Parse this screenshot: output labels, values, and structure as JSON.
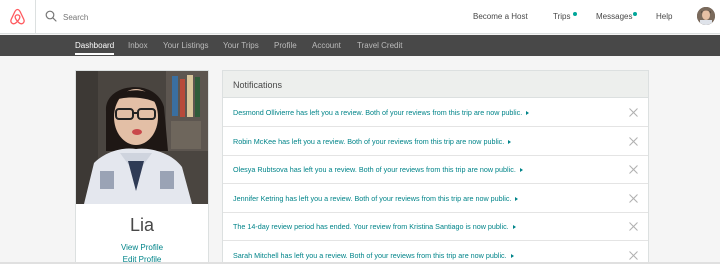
{
  "topbar": {
    "search_placeholder": "Search",
    "become_host": "Become a Host",
    "trips": "Trips",
    "messages": "Messages",
    "help": "Help"
  },
  "subnav": {
    "items": [
      "Dashboard",
      "Inbox",
      "Your Listings",
      "Your Trips",
      "Profile",
      "Account",
      "Travel Credit"
    ],
    "active": "Dashboard"
  },
  "profile": {
    "name": "Lia",
    "view_profile": "View Profile",
    "edit_profile": "Edit Profile"
  },
  "notifications": {
    "title": "Notifications",
    "items": [
      "Desmond Ollivierre has left you a review. Both of your reviews from this trip are now public.",
      "Robin McKee has left you a review. Both of your reviews from this trip are now public.",
      "Olesya Rubtsova has left you a review. Both of your reviews from this trip are now public.",
      "Jennifer Ketring has left you a review. Both of your reviews from this trip are now public.",
      "The 14-day review period has ended. Your review from Kristina Santiago is now public.",
      "Sarah Mitchell has left you a review. Both of your reviews from this trip are now public."
    ]
  },
  "colors": {
    "brand": "#ff5a5f",
    "link": "#008489",
    "badge": "#00a699",
    "subnav_bg": "#484848"
  }
}
